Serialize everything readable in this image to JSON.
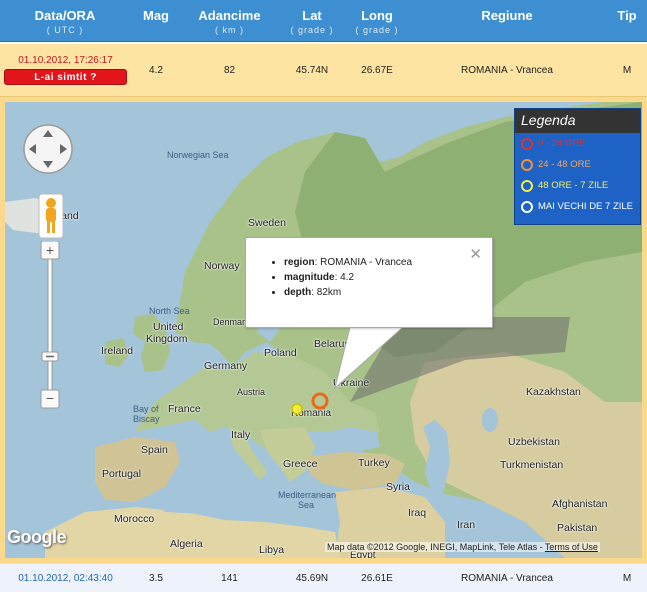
{
  "header": {
    "datetime_label": "Data/ORA",
    "datetime_sub": "( UTC )",
    "mag_label": "Mag",
    "depth_label": "Adancime",
    "depth_sub": "( km )",
    "lat_label": "Lat",
    "lat_sub": "( grade )",
    "long_label": "Long",
    "long_sub": "( grade )",
    "region_label": "Regiune",
    "type_label": "Tip"
  },
  "rows": [
    {
      "datetime": "01.10.2012, 17:26:17",
      "felt_button": "L-ai simtit ?",
      "mag": "4.2",
      "depth": "82",
      "lat": "45.74N",
      "long": "26.67E",
      "region": "ROMANIA - Vrancea",
      "type": "M"
    },
    {
      "datetime": "01.10.2012, 02:43:40",
      "mag": "3.5",
      "depth": "141",
      "lat": "45.69N",
      "long": "26.61E",
      "region": "ROMANIA - Vrancea",
      "type": "M"
    }
  ],
  "map": {
    "labels": {
      "norwegian_sea": "Norwegian Sea",
      "iceland": "eland",
      "sweden": "Sweden",
      "norway": "Norway",
      "north_sea": "North Sea",
      "united_kingdom_1": "United",
      "united_kingdom_2": "Kingdom",
      "ireland": "Ireland",
      "denmark": "Denmar",
      "belarus": "Belarus",
      "poland": "Poland",
      "germany": "Germany",
      "ukraine": "Ukraine",
      "austria": "Austria",
      "bay_of_biscay_1": "Bay of",
      "bay_of_biscay_2": "Biscay",
      "france": "France",
      "romania": "Romania",
      "italy": "Italy",
      "spain": "Spain",
      "greece": "Greece",
      "turkey": "Turkey",
      "portugal": "Portugal",
      "mediterranean_1": "Mediterranean",
      "mediterranean_2": "Sea",
      "morocco": "Morocco",
      "algeria": "Algeria",
      "libya": "Libya",
      "egypt": "Egypt",
      "syria": "Syria",
      "iraq": "Iraq",
      "iran": "Iran",
      "kazakhstan": "Kazakhstan",
      "uzbekistan": "Uzbekistan",
      "turkmenistan": "Turkmenistan",
      "afghanistan": "Afghanistan",
      "pakistan": "Pakistan"
    },
    "legend": {
      "title": "Legenda",
      "items": [
        {
          "label": "0 - 24 ORE",
          "color": "#d8323a",
          "text_color": "#d8323a"
        },
        {
          "label": "24 - 48 ORE",
          "color": "#f0923a",
          "text_color": "#f0a860"
        },
        {
          "label": "48 ORE - 7 ZILE",
          "color": "#f0ee46",
          "text_color": "#f5f060"
        },
        {
          "label": "MAI VECHI DE 7 ZILE",
          "color": "#ffffff",
          "text_color": "#ffffff"
        }
      ]
    },
    "popup": {
      "region_key": "region",
      "region_value": ": ROMANIA - Vrancea",
      "magnitude_key": "magnitude",
      "magnitude_value": ": 4.2",
      "depth_key": "depth",
      "depth_value": ": 82km",
      "close": "✕"
    },
    "google": "Google",
    "attribution": "Map data ©2012 Google, INEGI, MapLink, Tele Atlas - ",
    "terms": "Terms of Use",
    "zoom_in": "+",
    "zoom_out": "−"
  }
}
